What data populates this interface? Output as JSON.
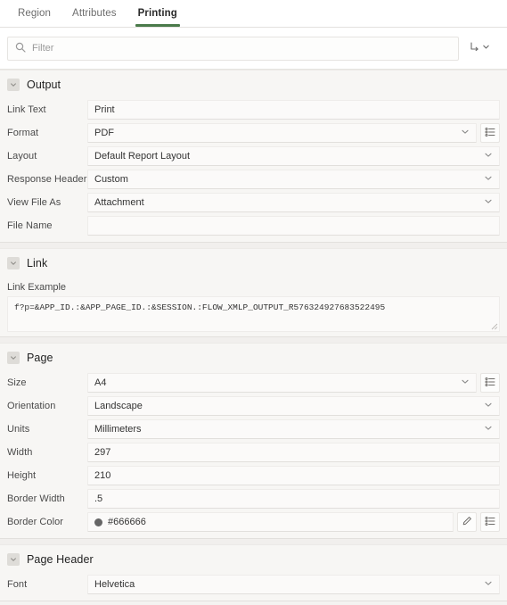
{
  "tabs": [
    {
      "label": "Region",
      "active": false
    },
    {
      "label": "Attributes",
      "active": false
    },
    {
      "label": "Printing",
      "active": true
    }
  ],
  "toolbar": {
    "search_placeholder": "Filter",
    "search_value": "",
    "search_icon": "search-icon",
    "utility_icon": "go-to-arrow-icon",
    "utility_chevron": "chevron-down-icon"
  },
  "accent_color": "#4a7a4a",
  "sections": {
    "output": {
      "title": "Output",
      "fields": {
        "link_text": {
          "label": "Link Text",
          "value": "Print"
        },
        "format": {
          "label": "Format",
          "value": "PDF"
        },
        "layout": {
          "label": "Layout",
          "value": "Default Report Layout"
        },
        "response_header": {
          "label": "Response Header",
          "value": "Custom"
        },
        "view_file_as": {
          "label": "View File As",
          "value": "Attachment"
        },
        "file_name": {
          "label": "File Name",
          "value": ""
        }
      }
    },
    "link": {
      "title": "Link",
      "fields": {
        "link_example": {
          "label": "Link Example",
          "value": "f?p=&APP_ID.:&APP_PAGE_ID.:&SESSION.:FLOW_XMLP_OUTPUT_R576324927683522495"
        }
      }
    },
    "page": {
      "title": "Page",
      "fields": {
        "size": {
          "label": "Size",
          "value": "A4"
        },
        "orientation": {
          "label": "Orientation",
          "value": "Landscape"
        },
        "units": {
          "label": "Units",
          "value": "Millimeters"
        },
        "width": {
          "label": "Width",
          "value": "297"
        },
        "height": {
          "label": "Height",
          "value": "210"
        },
        "border_width": {
          "label": "Border Width",
          "value": ".5"
        },
        "border_color": {
          "label": "Border Color",
          "value": "#666666",
          "swatch": "#666666"
        }
      }
    },
    "page_header": {
      "title": "Page Header",
      "fields": {
        "font": {
          "label": "Font",
          "value": "Helvetica"
        }
      }
    }
  },
  "icons": {
    "lov": "list-of-values-icon",
    "color_picker": "color-picker-icon",
    "collapse": "chevron-down-icon"
  }
}
